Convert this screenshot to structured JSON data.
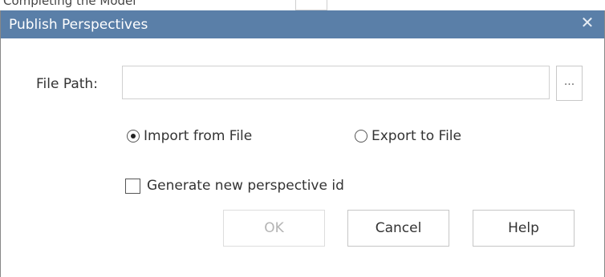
{
  "background_window": {
    "partial_text": "Completing the Model"
  },
  "dialog": {
    "title": "Publish Perspectives",
    "close_glyph": "✕",
    "file_path": {
      "label": "File Path:",
      "value": "",
      "placeholder": ""
    },
    "browse_button_label": "...",
    "mode_options": [
      {
        "label": "Import from File",
        "selected": true
      },
      {
        "label": "Export to File",
        "selected": false
      }
    ],
    "generate_new_id": {
      "label": "Generate new perspective id",
      "checked": false
    },
    "buttons": {
      "ok": {
        "label": "OK",
        "enabled": false
      },
      "cancel": {
        "label": "Cancel",
        "enabled": true
      },
      "help": {
        "label": "Help",
        "enabled": true
      }
    }
  },
  "colors": {
    "titlebar": "#5a7fa8",
    "title_text": "#ffffff",
    "disabled_text": "#b4b4b4"
  }
}
